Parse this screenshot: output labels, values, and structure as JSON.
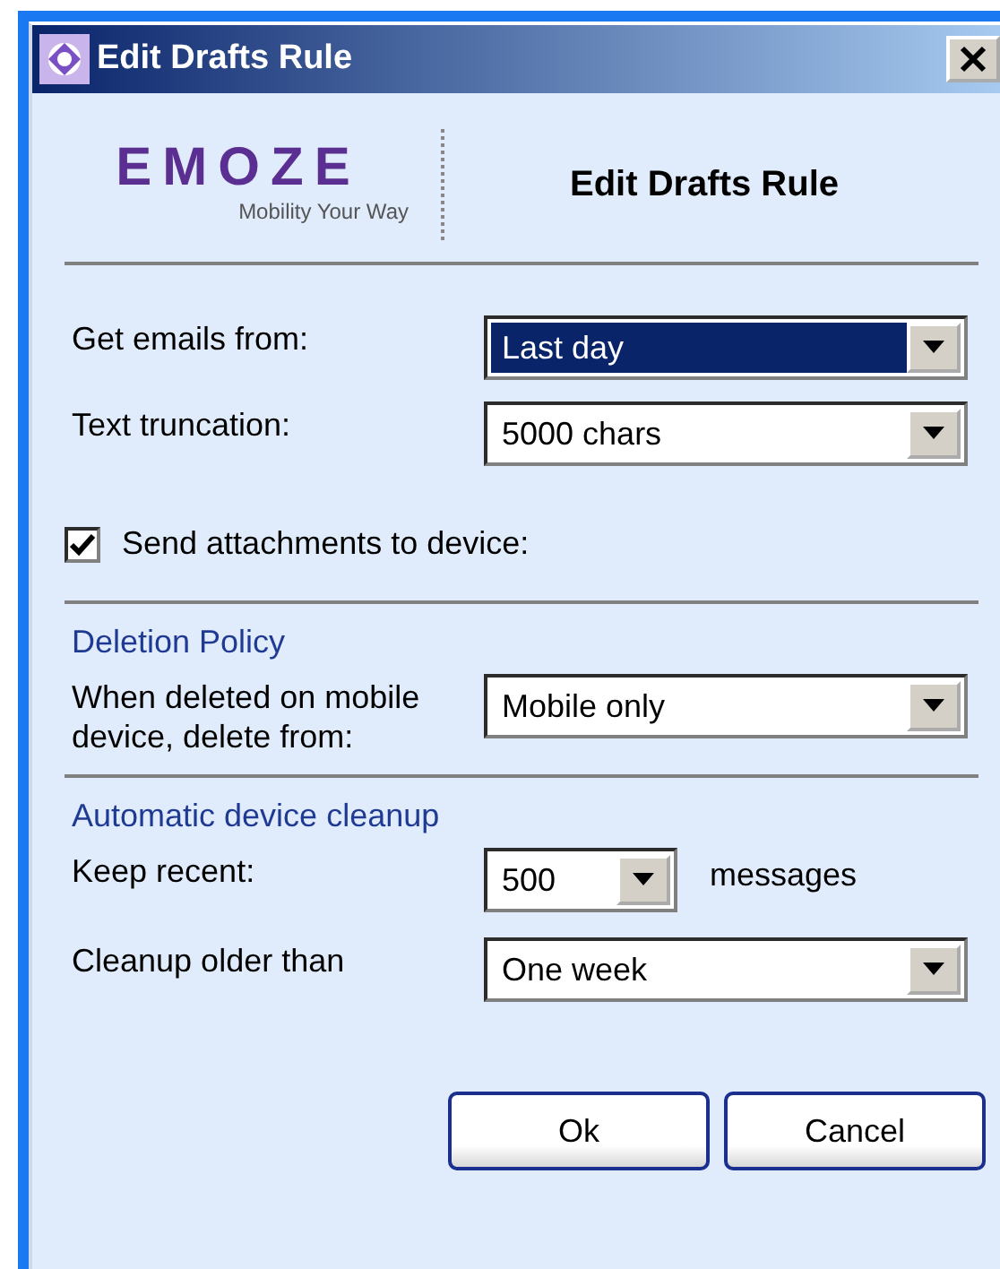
{
  "window": {
    "title": "Edit Drafts Rule"
  },
  "header": {
    "logo": {
      "wordmark": "EMOZE",
      "tagline": "Mobility Your Way"
    },
    "title": "Edit Drafts Rule"
  },
  "fields": [
    {
      "kind": "select",
      "label": "Get emails from:",
      "value": "Last day",
      "focused": true
    },
    {
      "kind": "select",
      "label": "Text truncation:",
      "value": "5000 chars",
      "focused": false
    },
    {
      "kind": "checkbox",
      "label": "Send attachments to device:",
      "checked": true
    }
  ],
  "sections": [
    {
      "title": "Deletion Policy",
      "fields": [
        {
          "kind": "select",
          "label": "When deleted on mobile device, delete from:",
          "value": "Mobile only",
          "focused": false
        }
      ]
    },
    {
      "title": "Automatic device cleanup",
      "fields": [
        {
          "kind": "select",
          "label": "Keep recent:",
          "value": "500",
          "suffix": "messages",
          "focused": false
        },
        {
          "kind": "select",
          "label": "Cleanup older than",
          "value": "One week",
          "focused": false
        }
      ]
    }
  ],
  "buttons": [
    "Ok",
    "Cancel"
  ]
}
